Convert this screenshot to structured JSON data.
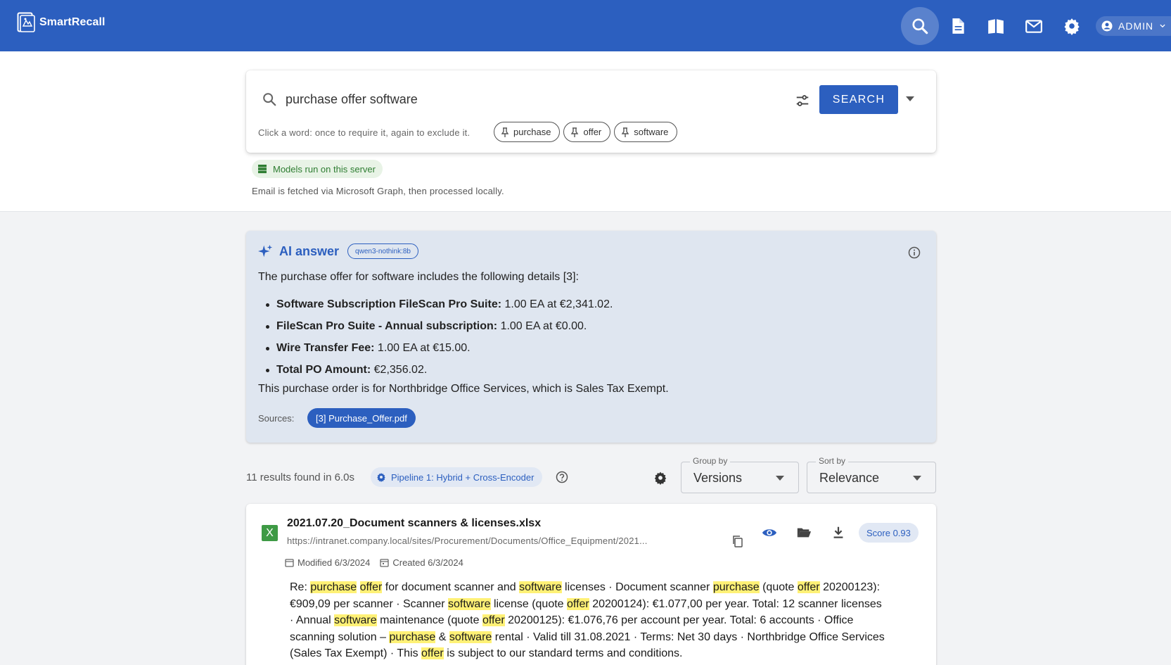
{
  "header": {
    "brand": "SmartRecall",
    "admin_label": "ADMIN",
    "nav": [
      {
        "icon": "search-icon",
        "active": true
      },
      {
        "icon": "document-icon",
        "active": false
      },
      {
        "icon": "book-icon",
        "active": false
      },
      {
        "icon": "mail-icon",
        "active": false
      },
      {
        "icon": "gear-icon",
        "active": false
      }
    ],
    "accent_color": "#2c5fbf"
  },
  "search": {
    "query": "purchase offer software",
    "button_label": "SEARCH",
    "hint": "Click a word: once to require it, again to exclude it.",
    "chips": [
      "purchase",
      "offer",
      "software"
    ]
  },
  "privacy": {
    "badge": "Models run on this server",
    "note": "Email is fetched via Microsoft Graph, then processed locally."
  },
  "ai_answer": {
    "title": "AI answer",
    "model": "qwen3-nothink:8b",
    "intro": "The purchase offer for software includes the following details [3]:",
    "items": [
      {
        "label": "Software Subscription FileScan Pro Suite:",
        "value": "1.00 EA at €2,341.02."
      },
      {
        "label": "FileScan Pro Suite - Annual subscription:",
        "value": "1.00 EA at €0.00."
      },
      {
        "label": "Wire Transfer Fee:",
        "value": "1.00 EA at €15.00."
      },
      {
        "label": "Total PO Amount:",
        "value": "€2,356.02."
      }
    ],
    "outro": "This purchase order is for Northbridge Office Services, which is Sales Tax Exempt.",
    "sources_label": "Sources:",
    "source": "[3] Purchase_Offer.pdf"
  },
  "results": {
    "summary": "11 results found in 6.0s",
    "pipeline": "Pipeline 1: Hybrid + Cross-Encoder",
    "group_by": {
      "label": "Group by",
      "value": "Versions"
    },
    "sort_by": {
      "label": "Sort by",
      "value": "Relevance"
    },
    "items": [
      {
        "file_type": "X",
        "name": "2021.07.20_Document scanners & licenses.xlsx",
        "url": "https://intranet.company.local/sites/Procurement/Documents/Office_Equipment/2021...",
        "score": "Score 0.93",
        "modified": "Modified 6/3/2024",
        "created": "Created 6/3/2024",
        "snippet": [
          {
            "t": "Re: "
          },
          {
            "t": "purchase",
            "h": true
          },
          {
            "t": " "
          },
          {
            "t": "offer",
            "h": true
          },
          {
            "t": " for document scanner and "
          },
          {
            "t": "software",
            "h": true
          },
          {
            "t": " licenses · Document scanner "
          },
          {
            "t": "purchase",
            "h": true
          },
          {
            "t": " (quote "
          },
          {
            "t": "offer",
            "h": true
          },
          {
            "t": " 20200123): €909,09 per scanner · Scanner "
          },
          {
            "t": "software",
            "h": true
          },
          {
            "t": " license (quote "
          },
          {
            "t": "offer",
            "h": true
          },
          {
            "t": " 20200124): €1.077,00 per year. Total: 12 scanner licenses · Annual "
          },
          {
            "t": "software",
            "h": true
          },
          {
            "t": " maintenance (quote "
          },
          {
            "t": "offer",
            "h": true
          },
          {
            "t": " 20200125): €1.076,76 per account per year. Total: 6 accounts · Office scanning solution – "
          },
          {
            "t": "purchase",
            "h": true
          },
          {
            "t": " & "
          },
          {
            "t": "software",
            "h": true
          },
          {
            "t": " rental · Valid till 31.08.2021 · Terms: Net 30 days · Northbridge Office Services (Sales Tax Exempt) · This "
          },
          {
            "t": "offer",
            "h": true
          },
          {
            "t": " is subject to our standard terms and conditions."
          }
        ]
      }
    ]
  }
}
